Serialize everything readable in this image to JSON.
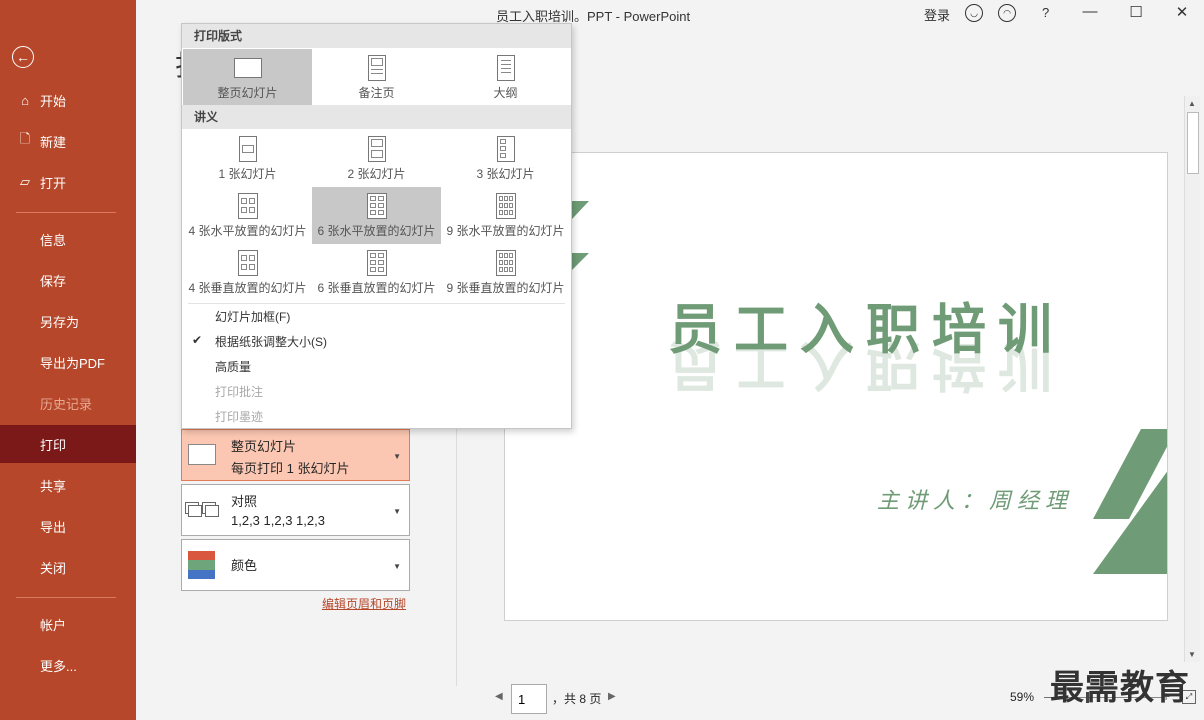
{
  "window": {
    "title": "员工入职培训。PPT  -  PowerPoint",
    "login": "登录",
    "help": "?"
  },
  "sidebar": {
    "items": [
      {
        "label": "开始",
        "icon": "home-icon"
      },
      {
        "label": "新建",
        "icon": "new-doc-icon"
      },
      {
        "label": "打开",
        "icon": "folder-open-icon"
      },
      {
        "label": "信息"
      },
      {
        "label": "保存"
      },
      {
        "label": "另存为"
      },
      {
        "label": "导出为PDF"
      },
      {
        "label": "历史记录"
      },
      {
        "label": "打印"
      },
      {
        "label": "共享"
      },
      {
        "label": "导出"
      },
      {
        "label": "关闭"
      },
      {
        "label": "帐户"
      },
      {
        "label": "更多..."
      }
    ]
  },
  "heading": "打",
  "dropdown": {
    "section_layout": "打印版式",
    "layout_options": [
      "整页幻灯片",
      "备注页",
      "大纲"
    ],
    "section_handouts": "讲义",
    "handouts": [
      "1 张幻灯片",
      "2 张幻灯片",
      "3 张幻灯片",
      "4 张水平放置的幻灯片",
      "6 张水平放置的幻灯片",
      "9 张水平放置的幻灯片",
      "4 张垂直放置的幻灯片",
      "6 张垂直放置的幻灯片",
      "9 张垂直放置的幻灯片"
    ],
    "options": [
      {
        "label": "幻灯片加框(F)",
        "checked": false,
        "enabled": true
      },
      {
        "label": "根据纸张调整大小(S)",
        "checked": true,
        "enabled": true
      },
      {
        "label": "高质量",
        "checked": false,
        "enabled": true
      },
      {
        "label": "打印批注",
        "checked": false,
        "enabled": false
      },
      {
        "label": "打印墨迹",
        "checked": false,
        "enabled": false
      }
    ]
  },
  "settings": {
    "layout": {
      "line1": "整页幻灯片",
      "line2": "每页打印 1 张幻灯片"
    },
    "collate": {
      "line1": "对照",
      "line2": "1,2,3     1,2,3     1,2,3"
    },
    "color": {
      "line1": "颜色"
    },
    "edit_link": "编辑页眉和页脚"
  },
  "preview": {
    "title": "员工入职培训",
    "subtitle": "主讲人：周经理",
    "accent_color": "#6f9c76"
  },
  "pager": {
    "current": "1",
    "total_text": "，共 8 页"
  },
  "zoom": {
    "percent": "59%",
    "minus": "–",
    "plus": "+"
  },
  "watermark": "最需教育",
  "colors": {
    "sidebar": "#b7472a",
    "sidebar_active": "#7b1818",
    "selected_setting": "#fbc7b2"
  }
}
